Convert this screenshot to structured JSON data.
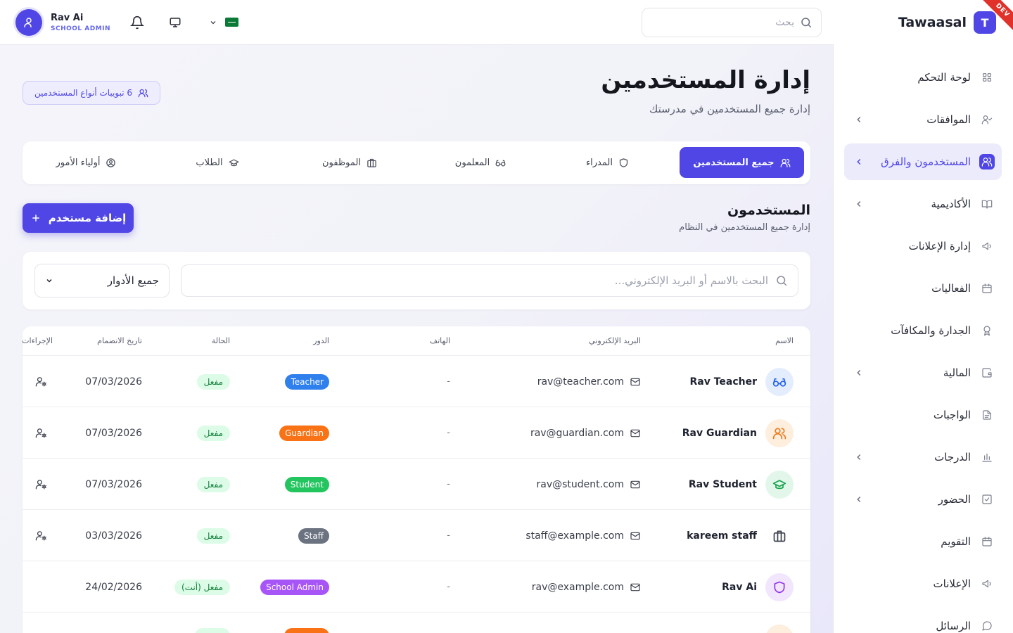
{
  "sidebar": {
    "brand_letter": "T",
    "brand_name": "Tawaasal",
    "env_badge": "DEV",
    "items": [
      {
        "label": "لوحة التحكم",
        "icon": "grid-icon",
        "chevron": false
      },
      {
        "label": "الموافقات",
        "icon": "user-check-icon",
        "chevron": true
      },
      {
        "label": "المستخدمون والفرق",
        "icon": "users-icon",
        "chevron": true,
        "active": true
      },
      {
        "label": "الأكاديمية",
        "icon": "book-icon",
        "chevron": true
      },
      {
        "label": "إدارة الإعلانات",
        "icon": "megaphone-icon",
        "chevron": false
      },
      {
        "label": "الفعاليات",
        "icon": "calendar-icon",
        "chevron": false
      },
      {
        "label": "الجدارة والمكافآت",
        "icon": "award-icon",
        "chevron": false
      },
      {
        "label": "المالية",
        "icon": "wallet-icon",
        "chevron": true
      },
      {
        "label": "الواجبات",
        "icon": "file-text-icon",
        "chevron": false
      },
      {
        "label": "الدرجات",
        "icon": "bar-chart-icon",
        "chevron": true
      },
      {
        "label": "الحضور",
        "icon": "check-square-icon",
        "chevron": true
      },
      {
        "label": "التقويم",
        "icon": "calendar-icon",
        "chevron": false
      },
      {
        "label": "الإعلانات",
        "icon": "megaphone-icon",
        "chevron": false
      },
      {
        "label": "الرسائل",
        "icon": "message-circle-icon",
        "chevron": false
      }
    ]
  },
  "topbar": {
    "search_placeholder": "بحث",
    "user_name": "Rav Ai",
    "user_role": "SCHOOL ADMIN"
  },
  "page": {
    "title": "إدارة المستخدمين",
    "subtitle": "إدارة جميع المستخدمين في مدرستك",
    "tabs_count_label": "6 تبويبات أنواع المستخدمين",
    "tabs": [
      {
        "label": "جميع المستخدمين",
        "icon": "users-icon",
        "active": true
      },
      {
        "label": "المدراء",
        "icon": "shield-icon"
      },
      {
        "label": "المعلمون",
        "icon": "glasses-icon"
      },
      {
        "label": "الموظفون",
        "icon": "briefcase-icon"
      },
      {
        "label": "الطلاب",
        "icon": "graduation-cap-icon"
      },
      {
        "label": "أولياء الأمور",
        "icon": "user-circle-icon"
      }
    ],
    "section_title": "المستخدمون",
    "section_subtitle": "إدارة جميع المستخدمين في النظام",
    "add_button": "إضافة مستخدم",
    "filter_search_placeholder": "البحث بالاسم أو البريد الإلكتروني...",
    "role_filter": "جميع الأدوار"
  },
  "table": {
    "headers": {
      "name": "الاسم",
      "email": "البريد الإلكتروني",
      "phone": "الهاتف",
      "role": "الدور",
      "status": "الحالة",
      "joined": "تاريخ الانضمام",
      "actions": "الإجراءات"
    },
    "rows": [
      {
        "name": "Rav Teacher",
        "email": "rav@teacher.com",
        "phone": "-",
        "role": "Teacher",
        "role_color": "#2f80ed",
        "status": "مفعل",
        "joined": "07/03/2026",
        "icon": "glasses-icon",
        "icon_color": "#2563eb",
        "icon_bg": "#e3edfd",
        "action": true
      },
      {
        "name": "Rav Guardian",
        "email": "rav@guardian.com",
        "phone": "-",
        "role": "Guardian",
        "role_color": "#f97316",
        "status": "مفعل",
        "joined": "07/03/2026",
        "icon": "users-icon",
        "icon_color": "#ea7a1e",
        "icon_bg": "#fdeedd",
        "action": true
      },
      {
        "name": "Rav Student",
        "email": "rav@student.com",
        "phone": "-",
        "role": "Student",
        "role_color": "#22c55e",
        "status": "مفعل",
        "joined": "07/03/2026",
        "icon": "graduation-cap-icon",
        "icon_color": "#16a34a",
        "icon_bg": "#e2f7ea",
        "action": true
      },
      {
        "name": "kareem staff",
        "email": "staff@example.com",
        "phone": "-",
        "role": "Staff",
        "role_color": "#6b7280",
        "status": "مفعل",
        "joined": "03/03/2026",
        "icon": "briefcase-icon",
        "icon_color": "#3a3e4a",
        "icon_bg": "#ffffff",
        "action": true
      },
      {
        "name": "Rav Ai",
        "email": "rav@example.com",
        "phone": "-",
        "role": "School Admin",
        "role_color": "#a855f7",
        "status": "مفعل (أنت)",
        "joined": "24/02/2026",
        "icon": "shield-icon",
        "icon_color": "#9333ea",
        "icon_bg": "#f1e6fd",
        "action": false
      }
    ]
  }
}
